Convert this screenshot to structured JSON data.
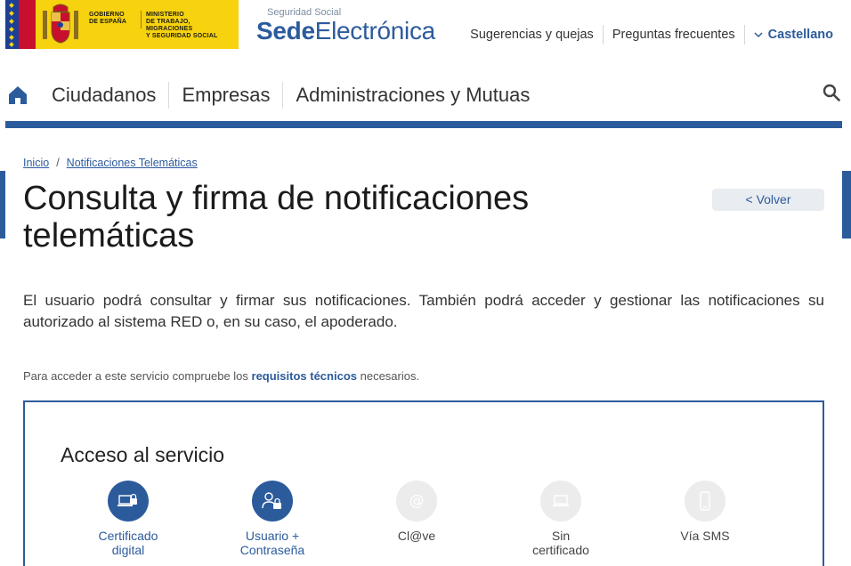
{
  "header": {
    "gov_line1": [
      "GOBIERNO",
      "DE ESPAÑA"
    ],
    "gov_line2": [
      "MINISTERIO",
      "DE TRABAJO, MIGRACIONES",
      "Y SEGURIDAD SOCIAL"
    ],
    "sede_small": "Seguridad Social",
    "sede_bold": "Sede",
    "sede_light": "Electrónica",
    "links": [
      "Sugerencias y quejas",
      "Preguntas frecuentes"
    ],
    "language": "Castellano"
  },
  "nav": {
    "items": [
      "Ciudadanos",
      "Empresas",
      "Administraciones y Mutuas"
    ]
  },
  "breadcrumb": {
    "home": "Inicio",
    "separator": "/",
    "current": "Notificaciones Telemáticas"
  },
  "page": {
    "title": "Consulta y firma de notificaciones telemáticas",
    "back_label": "< Volver",
    "intro": "El usuario podrá consultar y firmar sus notificaciones. También podrá acceder y gestionar las notificaciones su autorizado al sistema RED o, en su caso, el apoderado.",
    "reqs_before": "Para acceder a este servicio compruebe los ",
    "reqs_link": "requisitos técnicos",
    "reqs_after": " necesarios."
  },
  "access": {
    "title": "Acceso al servicio",
    "methods": [
      {
        "line1": "Certificado",
        "line2": "digital",
        "icon": "certificate-laptop-lock-icon",
        "enabled": true
      },
      {
        "line1": "Usuario +",
        "line2": "Contraseña",
        "icon": "user-lock-icon",
        "enabled": true
      },
      {
        "line1": "Cl@ve",
        "line2": "",
        "icon": "at-sign-icon",
        "enabled": false
      },
      {
        "line1": "Sin",
        "line2": "certificado",
        "icon": "laptop-icon",
        "enabled": false
      },
      {
        "line1": "Vía SMS",
        "line2": "",
        "icon": "phone-icon",
        "enabled": false
      }
    ]
  },
  "colors": {
    "brand_blue": "#2c5b9c",
    "gov_yellow": "#f6d20f",
    "disabled_grey": "#ececec"
  }
}
